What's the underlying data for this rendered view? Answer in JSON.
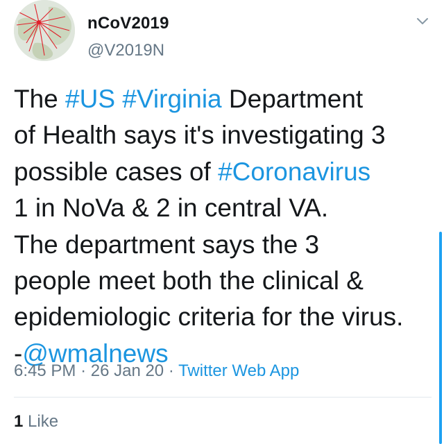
{
  "account": {
    "display_name": "nCoV2019",
    "handle": "@V2019N"
  },
  "tweet": {
    "lines": [
      [
        "The ",
        "#US",
        " ",
        "#Virginia",
        " Department"
      ],
      [
        "of Health says it's investigating 3"
      ],
      [
        "possible cases of ",
        "#Coronavirus"
      ],
      [
        "1 in NoVa & 2 in central VA."
      ],
      [
        "The department says the 3"
      ],
      [
        "people meet both the clinical &"
      ],
      [
        "epidemiologic criteria for the virus."
      ],
      [
        "-",
        "@wmalnews"
      ]
    ],
    "time": "6:45 PM",
    "separator": "·",
    "date": "26 Jan 20",
    "source": "Twitter Web App"
  },
  "engagement": {
    "like_count": "1",
    "like_label": "Like"
  },
  "colors": {
    "link": "#1b95e0",
    "text": "#14171a",
    "secondary": "#657786",
    "divider": "#e1e8ed",
    "scrollbar": "#1da1f2"
  },
  "icons": {
    "avatar": "network-map-avatar",
    "menu": "chevron-down-icon"
  }
}
